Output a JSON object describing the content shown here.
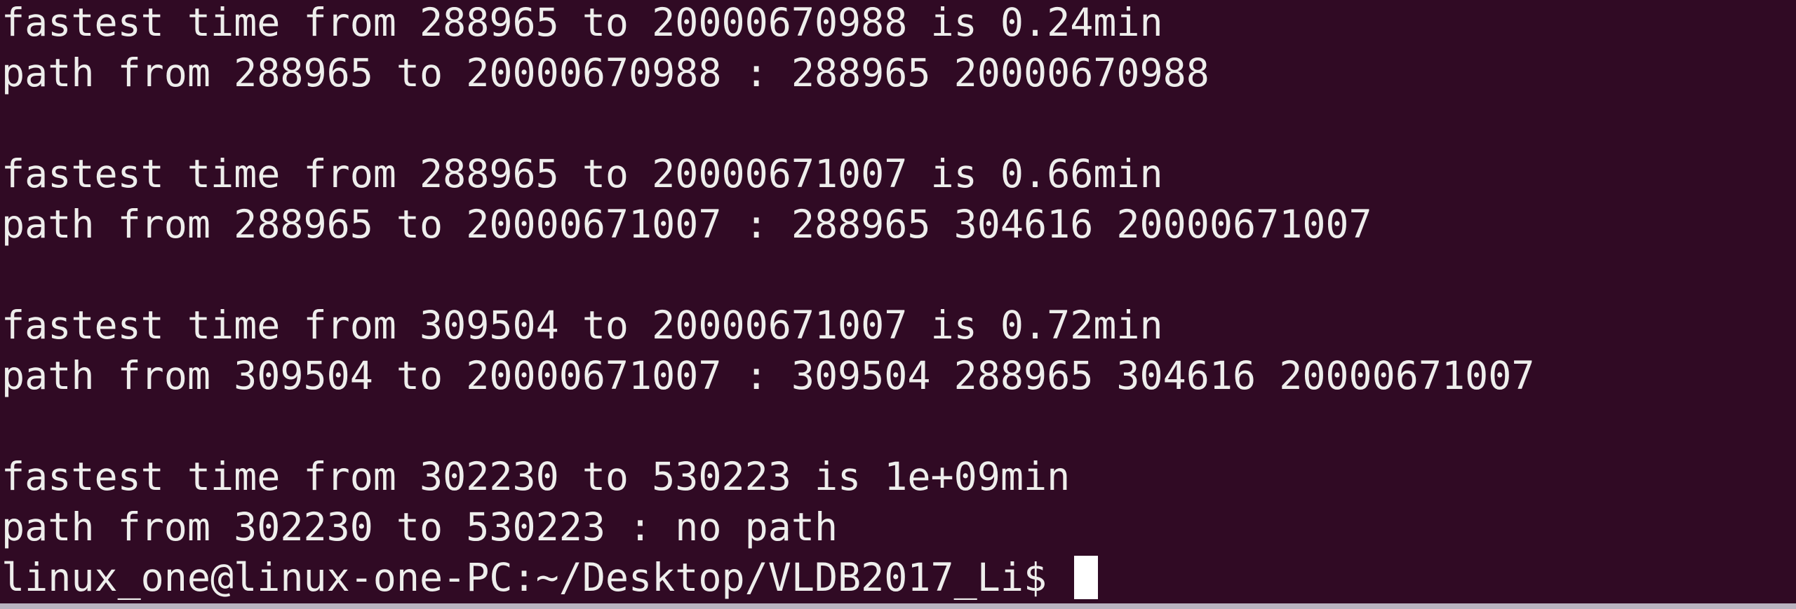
{
  "terminal": {
    "lines": [
      "fastest time from 288965 to 20000670988 is 0.24min",
      "path from 288965 to 20000670988 : 288965 20000670988",
      "",
      "fastest time from 288965 to 20000671007 is 0.66min",
      "path from 288965 to 20000671007 : 288965 304616 20000671007",
      "",
      "fastest time from 309504 to 20000671007 is 0.72min",
      "path from 309504 to 20000671007 : 309504 288965 304616 20000671007",
      "",
      "fastest time from 302230 to 530223 is 1e+09min",
      "path from 302230 to 530223 : no path"
    ],
    "prompt": "linux_one@linux-one-PC:~/Desktop/VLDB2017_Li$ ",
    "colors": {
      "background": "#300a24",
      "text": "#eeeeec",
      "cursor": "#ffffff"
    }
  }
}
